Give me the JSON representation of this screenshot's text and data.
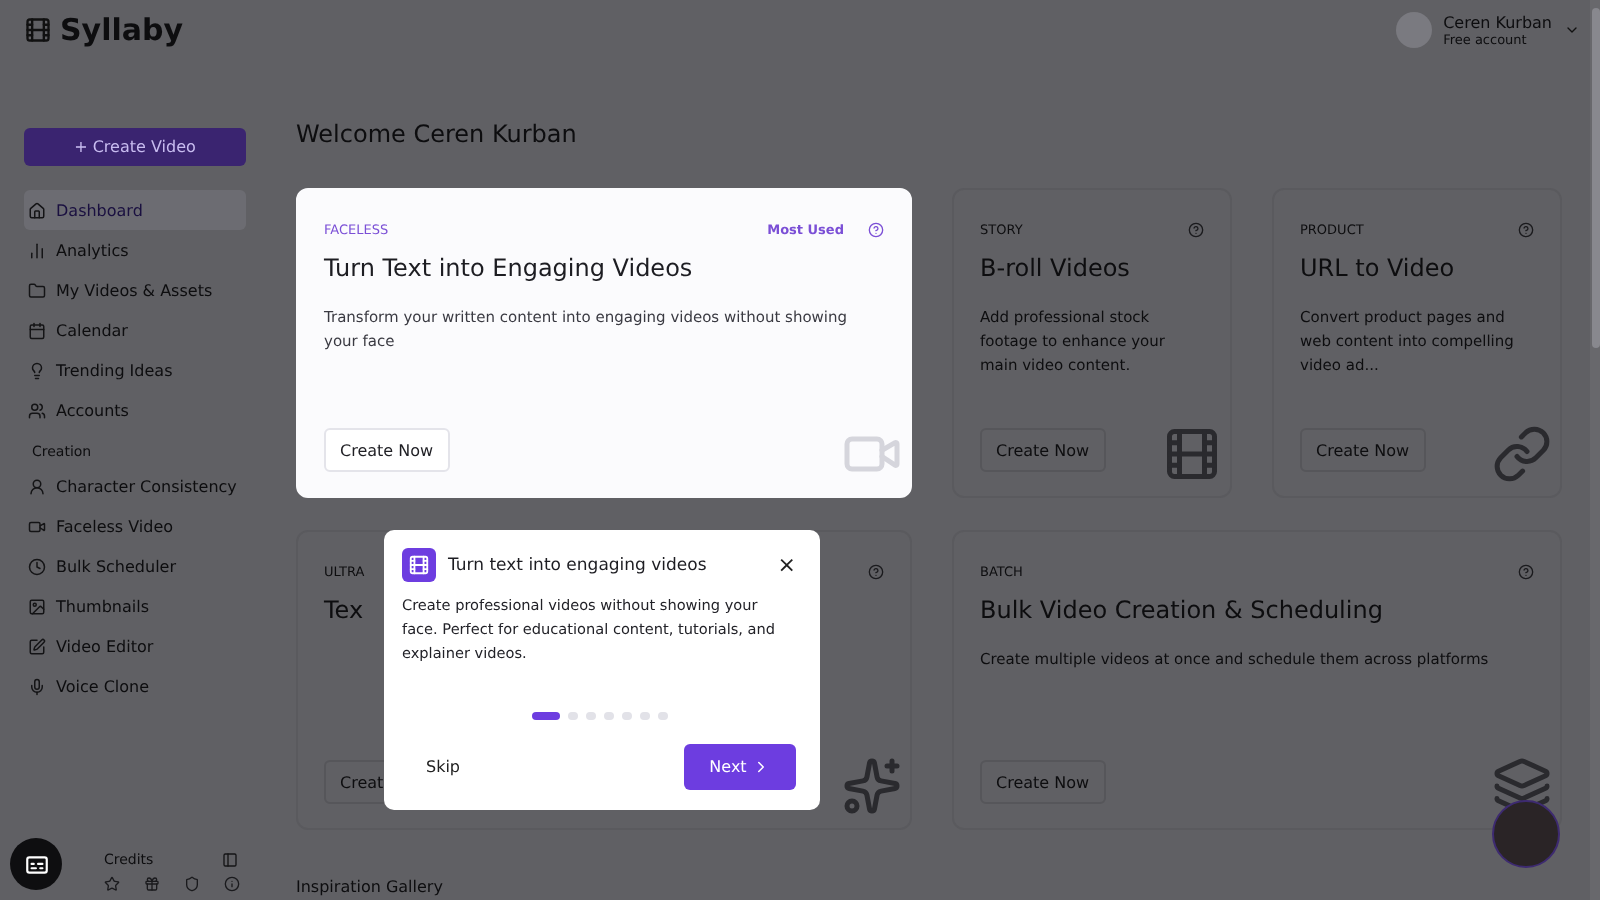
{
  "brand": "Syllaby",
  "user": {
    "name": "Ceren Kurban",
    "plan": "Free account"
  },
  "create_button": "+ Create Video",
  "nav": [
    {
      "label": "Dashboard",
      "selected": true
    },
    {
      "label": "Analytics",
      "selected": false
    },
    {
      "label": "My Videos & Assets",
      "selected": false
    },
    {
      "label": "Calendar",
      "selected": false
    },
    {
      "label": "Trending Ideas",
      "selected": false
    },
    {
      "label": "Accounts",
      "selected": false
    }
  ],
  "section_title": "Creation",
  "creation": [
    {
      "label": "Character Consistency",
      "selected": false
    },
    {
      "label": "Faceless Video",
      "selected": false
    },
    {
      "label": "Bulk Scheduler",
      "selected": false
    },
    {
      "label": "Thumbnails",
      "selected": false
    },
    {
      "label": "Video Editor",
      "selected": false
    },
    {
      "label": "Voice Clone",
      "selected": false
    }
  ],
  "credits_label": "Credits",
  "welcome": "Welcome Ceren Kurban",
  "cards": [
    {
      "tag": "FACELESS",
      "badge": "Most Used",
      "title": "Turn Text into Engaging Videos",
      "description": "Transform your written content into engaging videos without showing your face",
      "button": "Create Now",
      "highlighted": true
    },
    {
      "tag": "STORY",
      "title": "B-roll Videos",
      "description": "Add professional stock footage to enhance your main video content.",
      "button": "Create Now",
      "highlighted": false
    },
    {
      "tag": "PRODUCT",
      "title": "URL to Video",
      "description": "Convert product pages and web content into compelling video ad...",
      "button": "Create Now",
      "highlighted": false
    },
    {
      "tag": "ULTRA",
      "title": "Tex",
      "button": "Creat",
      "highlighted": false
    },
    {
      "tag": "BATCH",
      "title": "Bulk Video Creation & Scheduling",
      "description": "Create multiple videos at once and schedule them across platforms",
      "button": "Create Now",
      "highlighted": false
    }
  ],
  "gallery_title": "Inspiration Gallery",
  "tour": {
    "title": "Turn text into engaging videos",
    "close": "×",
    "body": "Create professional videos without showing your face. Perfect for educational content, tutorials, and explainer videos.",
    "steps": [
      {
        "selected": true
      },
      {
        "selected": false
      },
      {
        "selected": false
      },
      {
        "selected": false
      },
      {
        "selected": false
      },
      {
        "selected": false
      },
      {
        "selected": false
      }
    ],
    "skip": "Skip",
    "next": "Next"
  }
}
